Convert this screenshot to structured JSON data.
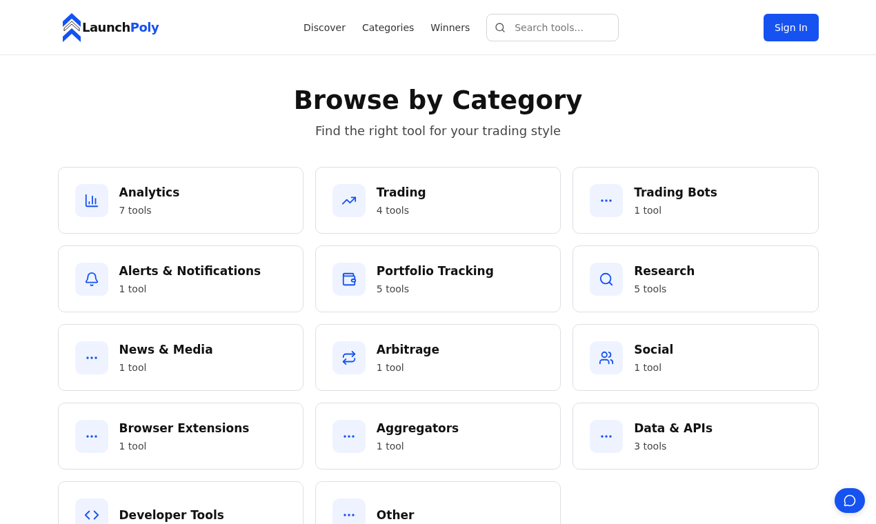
{
  "header": {
    "logo": {
      "first": "Launch",
      "second": "Poly"
    },
    "nav": [
      "Discover",
      "Categories",
      "Winners"
    ],
    "search": {
      "placeholder": "Search tools..."
    },
    "sign_in": "Sign In"
  },
  "hero": {
    "title": "Browse by Category",
    "subtitle": "Find the right tool for your trading style"
  },
  "categories": [
    {
      "kind": "chart",
      "name": "Analytics",
      "count": "7 tools"
    },
    {
      "kind": "trend",
      "name": "Trading",
      "count": "4 tools"
    },
    {
      "kind": "dots",
      "name": "Trading Bots",
      "count": "1 tool"
    },
    {
      "kind": "bell",
      "name": "Alerts & Notifications",
      "count": "1 tool"
    },
    {
      "kind": "wallet",
      "name": "Portfolio Tracking",
      "count": "5 tools"
    },
    {
      "kind": "search",
      "name": "Research",
      "count": "5 tools"
    },
    {
      "kind": "dots",
      "name": "News & Media",
      "count": "1 tool"
    },
    {
      "kind": "repeat",
      "name": "Arbitrage",
      "count": "1 tool"
    },
    {
      "kind": "users",
      "name": "Social",
      "count": "1 tool"
    },
    {
      "kind": "dots",
      "name": "Browser Extensions",
      "count": "1 tool"
    },
    {
      "kind": "dots",
      "name": "Aggregators",
      "count": "1 tool"
    },
    {
      "kind": "dots",
      "name": "Data & APIs",
      "count": "3 tools"
    },
    {
      "kind": "code",
      "name": "Developer Tools"
    },
    {
      "kind": "dots",
      "name": "Other"
    }
  ]
}
